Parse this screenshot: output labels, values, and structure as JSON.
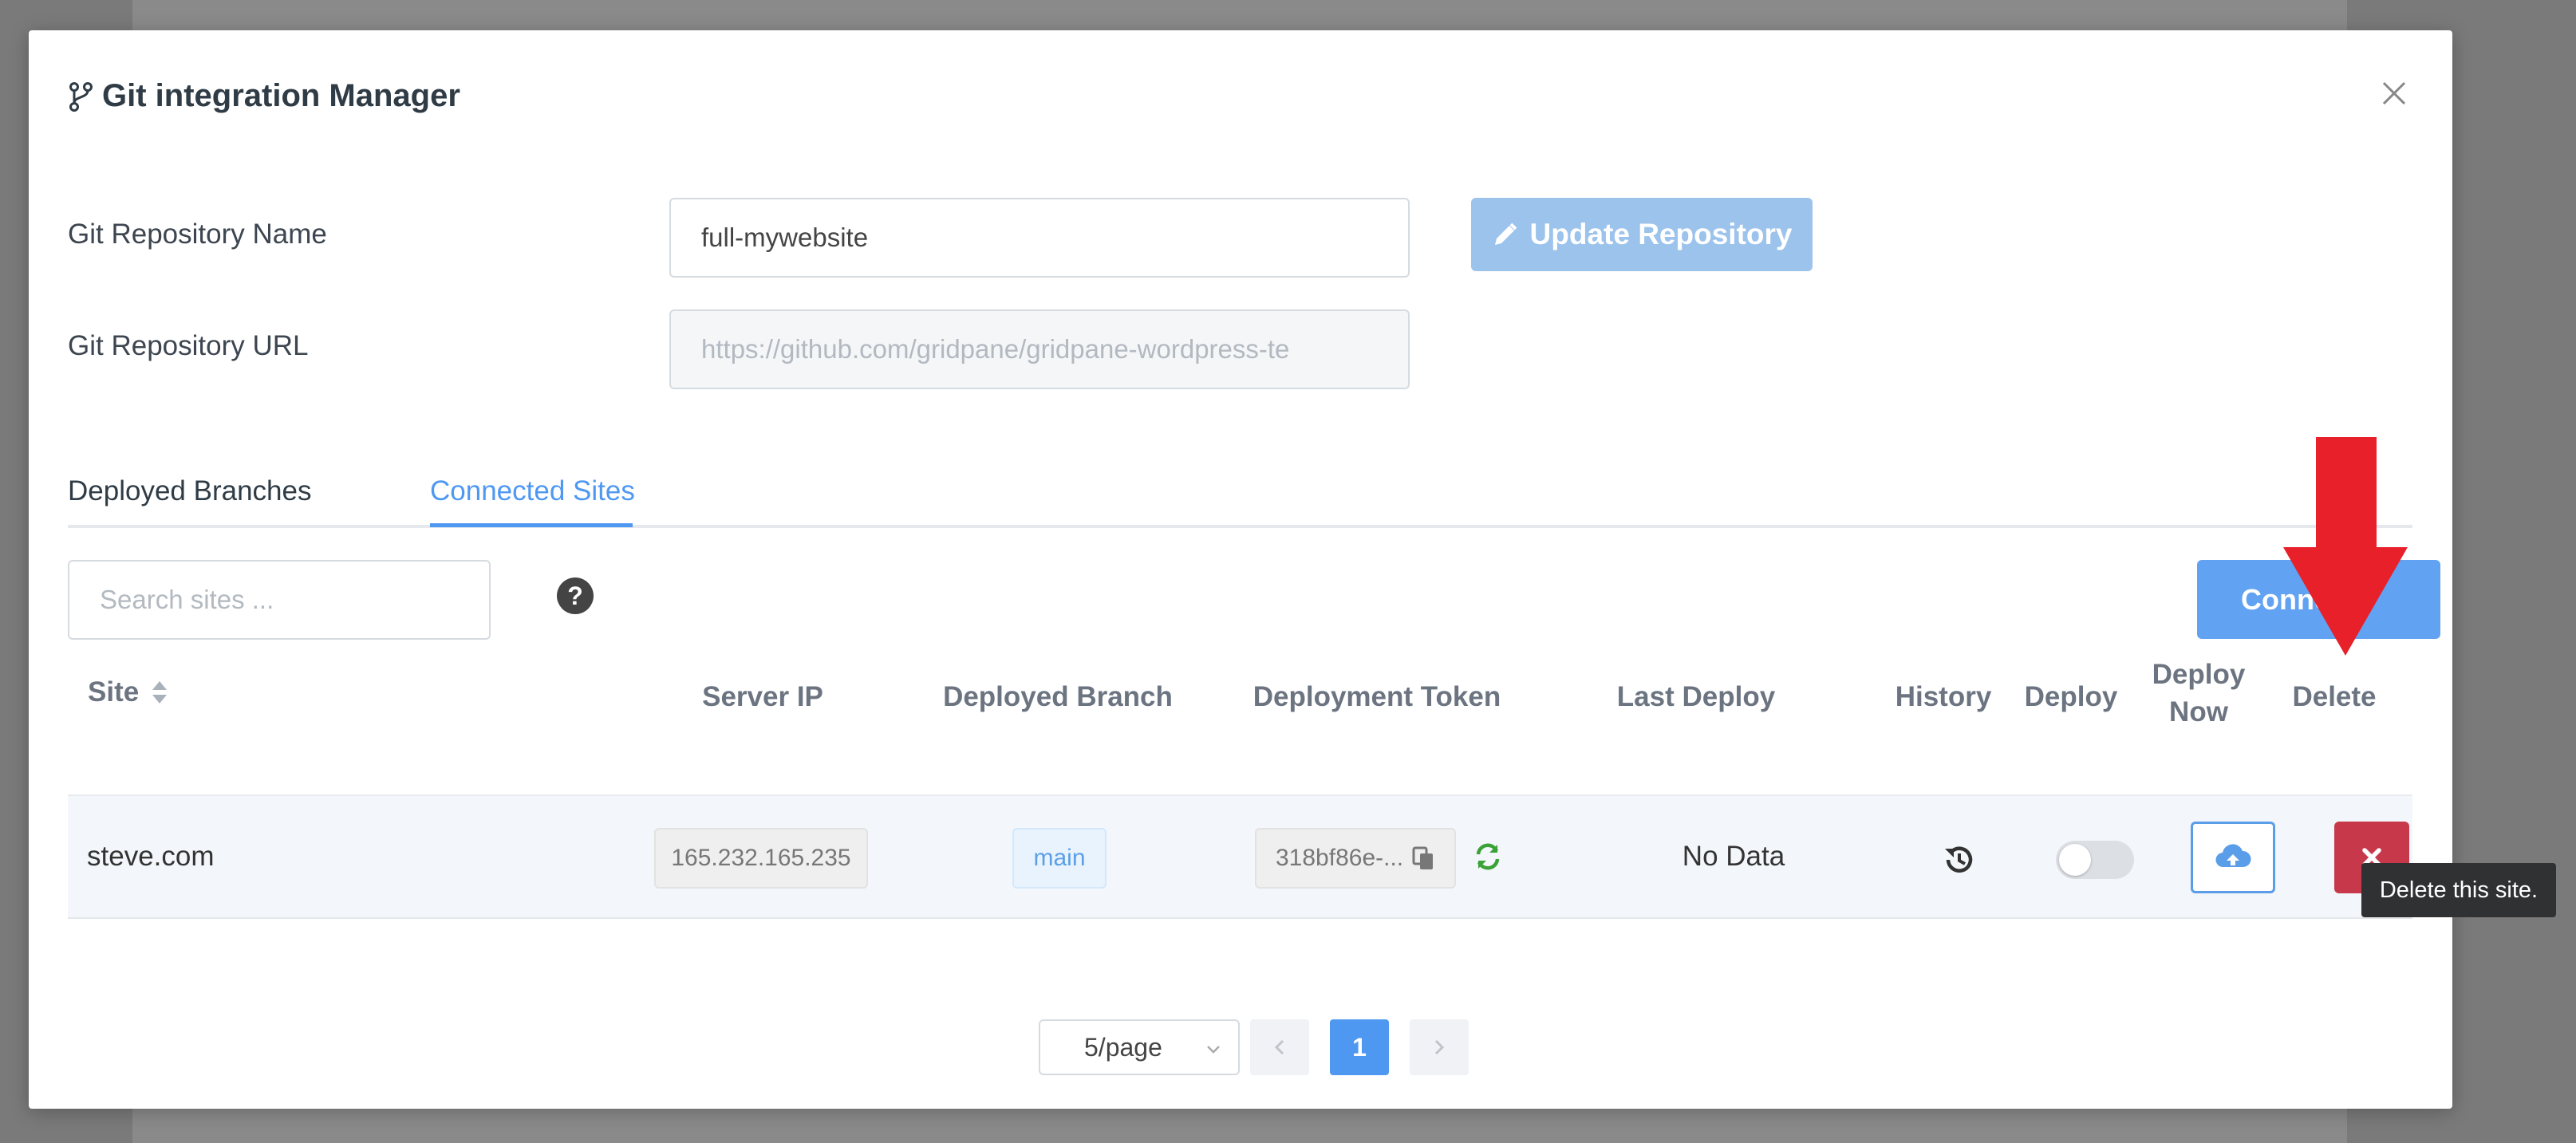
{
  "modal": {
    "title": "Git integration Manager"
  },
  "form": {
    "repo_name_label": "Git Repository Name",
    "repo_name_value": "full-mywebsite",
    "repo_url_label": "Git Repository URL",
    "repo_url_placeholder": "https://github.com/gridpane/gridpane-wordpress-te",
    "update_button_label": "Update Repository"
  },
  "tabs": [
    {
      "label": "Deployed Branches",
      "active": false
    },
    {
      "label": "Connected Sites",
      "active": true
    }
  ],
  "toolbar": {
    "search_placeholder": "Search sites ...",
    "help_label": "?",
    "connect_button_label": "Connect"
  },
  "table": {
    "headers": {
      "site": "Site",
      "server_ip": "Server IP",
      "deployed_branch": "Deployed Branch",
      "deployment_token": "Deployment Token",
      "last_deploy": "Last Deploy",
      "history": "History",
      "deploy": "Deploy",
      "deploy_now_1": "Deploy",
      "deploy_now_2": "Now",
      "delete": "Delete"
    },
    "rows": [
      {
        "site": "steve.com",
        "server_ip": "165.232.165.235",
        "branch": "main",
        "token": "318bf86e-...",
        "last_deploy": "No Data",
        "deploy_enabled": false
      }
    ]
  },
  "tooltip": {
    "text": "Delete this site."
  },
  "pagination": {
    "page_size": "5/page",
    "current_page": "1"
  },
  "colors": {
    "accent": "#4f98f2",
    "delete": "#c7394a",
    "annotation_arrow": "#e8202a"
  },
  "icons": [
    "git-branch-icon",
    "close-icon",
    "pencil-icon",
    "help-icon",
    "sort-icon",
    "copy-icon",
    "refresh-icon",
    "history-icon",
    "cloud-upload-icon",
    "delete-x-icon",
    "chevron-down-icon",
    "chevron-left-icon",
    "chevron-right-icon"
  ]
}
